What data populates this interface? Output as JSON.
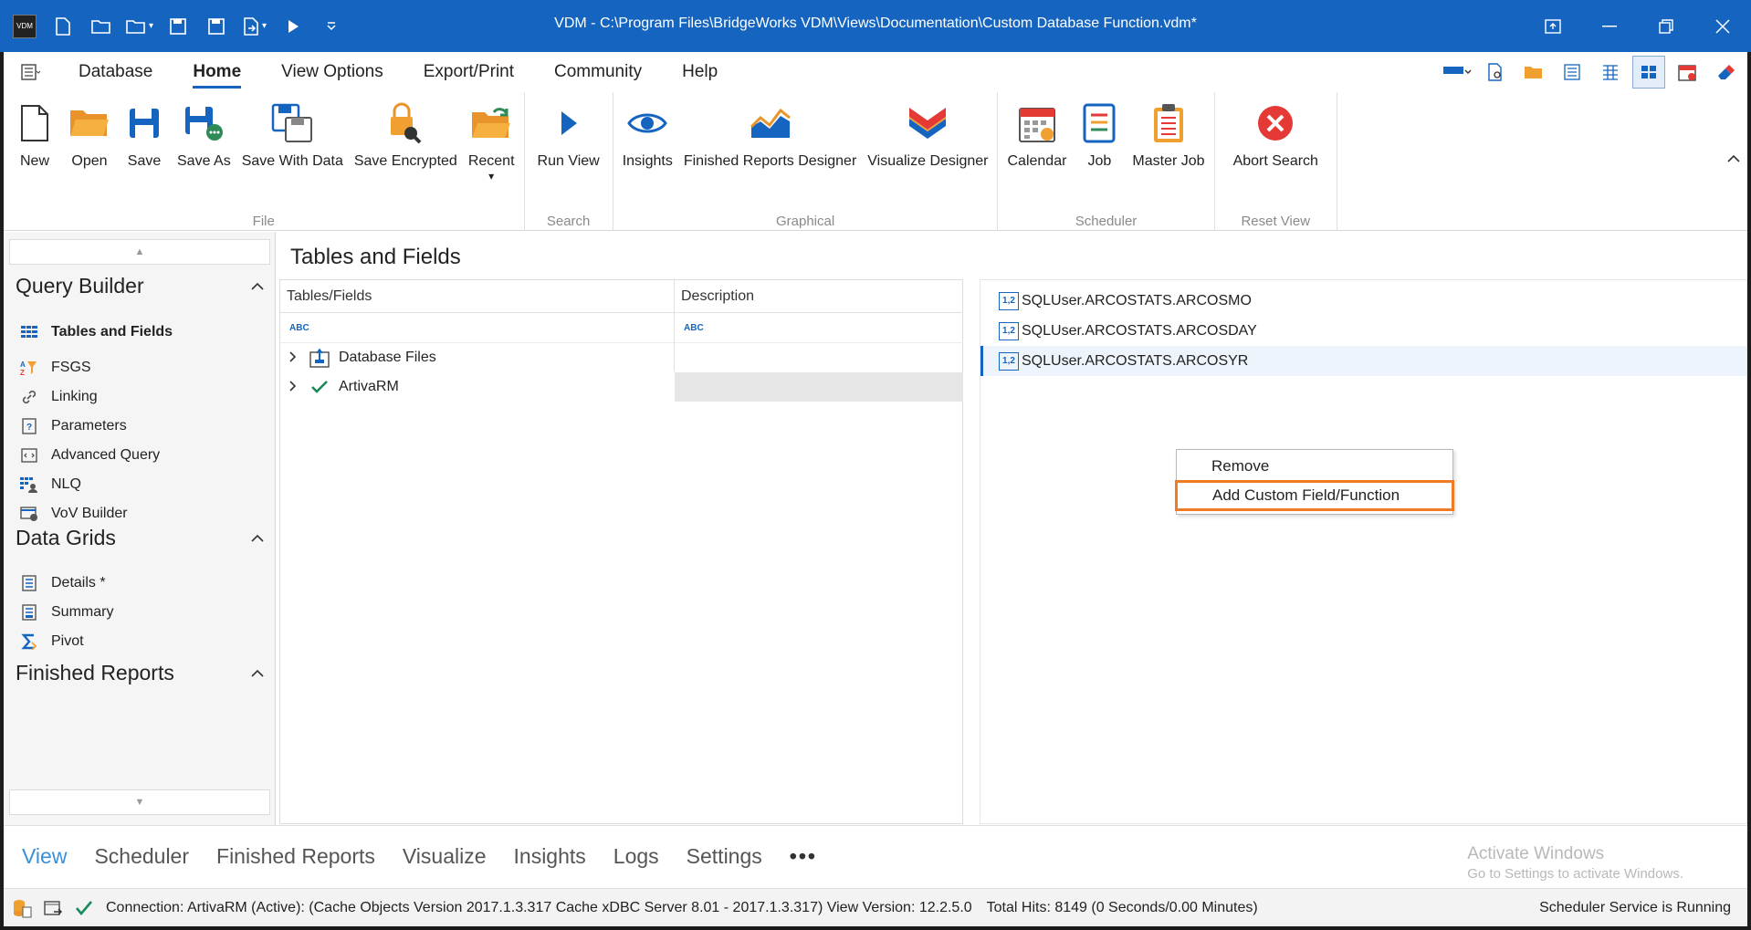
{
  "titlebar": {
    "title": "VDM - C:\\Program Files\\BridgeWorks VDM\\Views\\Documentation\\Custom Database Function.vdm*",
    "logo_text": "VDM"
  },
  "menu": {
    "tabs": [
      "Database",
      "Home",
      "View Options",
      "Export/Print",
      "Community",
      "Help"
    ],
    "active": "Home"
  },
  "ribbon": {
    "groups": {
      "file": {
        "label": "File",
        "buttons": [
          "New",
          "Open",
          "Save",
          "Save As",
          "Save With Data",
          "Save Encrypted",
          "Recent"
        ]
      },
      "search": {
        "label": "Search",
        "buttons": [
          "Run View"
        ]
      },
      "graphical": {
        "label": "Graphical",
        "buttons": [
          "Insights",
          "Finished Reports Designer",
          "Visualize Designer"
        ]
      },
      "scheduler": {
        "label": "Scheduler",
        "buttons": [
          "Calendar",
          "Job",
          "Master Job"
        ]
      },
      "reset_view": {
        "label": "Reset View",
        "buttons": [
          "Abort Search"
        ]
      }
    }
  },
  "leftnav": {
    "sections": [
      {
        "title": "Query Builder",
        "items": [
          "Tables and Fields",
          "FSGS",
          "Linking",
          "Parameters",
          "Advanced Query",
          "NLQ",
          "VoV Builder"
        ]
      },
      {
        "title": "Data Grids",
        "items": [
          "Details *",
          "Summary",
          "Pivot"
        ]
      },
      {
        "title": "Finished Reports",
        "items": []
      }
    ],
    "active_item": "Tables and Fields"
  },
  "main": {
    "title": "Tables and Fields",
    "grid": {
      "columns": [
        "Tables/Fields",
        "Description"
      ],
      "filter_glyph": "ABC",
      "rows": [
        "Database Files",
        "ArtivaRM"
      ]
    },
    "fields": [
      "SQLUser.ARCOSTATS.ARCOSMO",
      "SQLUser.ARCOSTATS.ARCOSDAY",
      "SQLUser.ARCOSTATS.ARCOSYR"
    ],
    "field_icon_text": "1,2",
    "context_menu": [
      "Remove",
      "Add Custom Field/Function"
    ]
  },
  "bottom_tabs": [
    "View",
    "Scheduler",
    "Finished Reports",
    "Visualize",
    "Insights",
    "Logs",
    "Settings"
  ],
  "bottom_more": "•••",
  "watermark": {
    "line1": "Activate Windows",
    "line2": "Go to Settings to activate Windows."
  },
  "status": {
    "connection": "Connection: ArtivaRM (Active): (Cache Objects Version 2017.1.3.317 Cache xDBC Server 8.01 - 2017.1.3.317) View Version: 12.2.5.0",
    "hits": "Total Hits: 8149 (0 Seconds/0.00 Minutes)",
    "scheduler": "Scheduler Service is Running"
  },
  "colors": {
    "titlebar": "#1565c0",
    "accent_orange": "#f07b22",
    "accent_blue": "#1565c0"
  }
}
